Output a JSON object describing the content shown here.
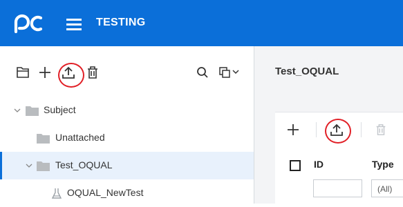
{
  "app": {
    "title": "TESTING",
    "brand_color": "#0b6fd9",
    "logo_icon": "pc-logo"
  },
  "toolbar": {
    "icons": [
      "folder-icon",
      "add-icon",
      "upload-icon",
      "delete-icon",
      "search-icon",
      "copy-icon",
      "chevron-down-icon"
    ]
  },
  "tree": {
    "items": [
      {
        "label": "Subject",
        "icon": "folder-icon",
        "expand": "chevron-down-icon"
      },
      {
        "label": "Unattached",
        "icon": "folder-icon"
      },
      {
        "label": "Test_OQUAL",
        "icon": "folder-icon",
        "expand": "chevron-down-icon",
        "selected": true
      },
      {
        "label": "OQUAL_NewTest",
        "icon": "test-icon"
      }
    ]
  },
  "main": {
    "title": "Test_OQUAL",
    "grid": {
      "toolbar_icons": [
        "add-icon",
        "upload-icon",
        "delete-icon"
      ],
      "columns": [
        {
          "header": "ID",
          "filter": ""
        },
        {
          "header": "Type",
          "filter": "(All)"
        }
      ]
    }
  },
  "annotation_color": "#e11f26"
}
